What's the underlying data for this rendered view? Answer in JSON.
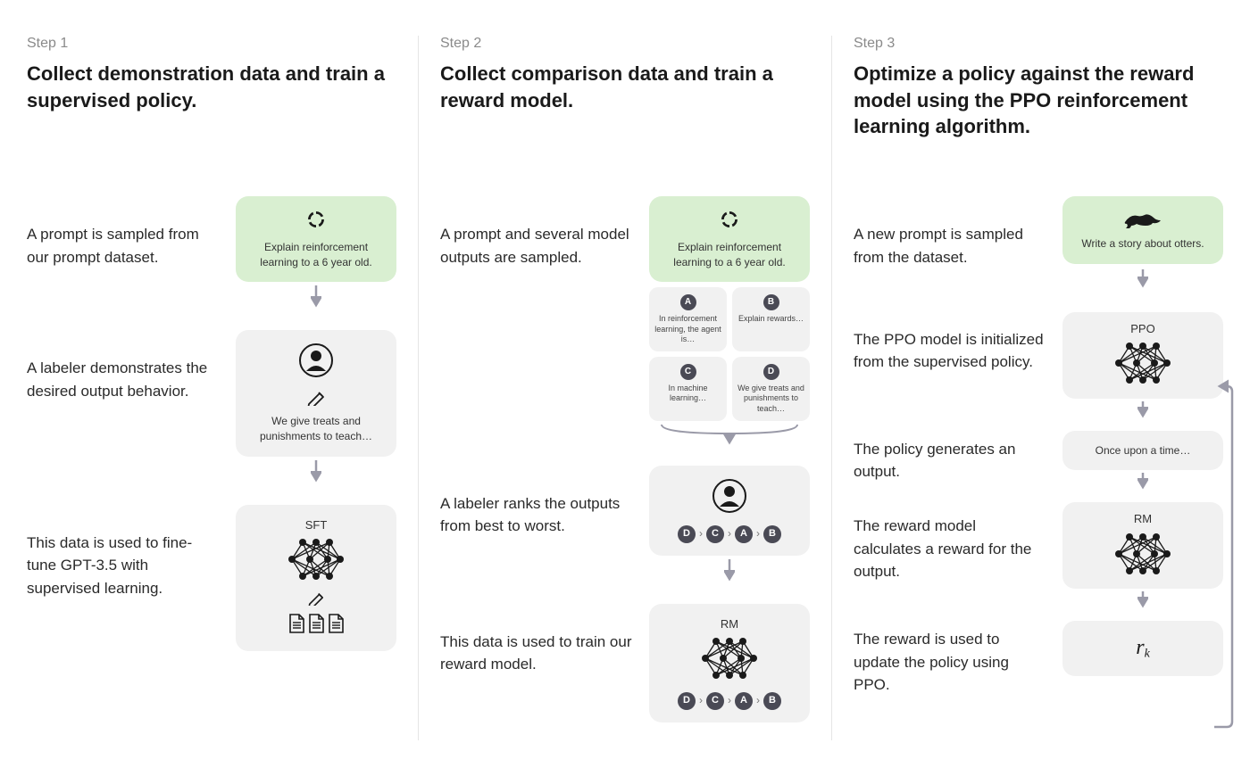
{
  "steps": [
    {
      "label": "Step 1",
      "title": "Collect demonstration data and train a supervised policy.",
      "rows": [
        {
          "text": "A prompt is sampled from our prompt dataset.",
          "prompt": "Explain reinforcement learning to a 6 year old."
        },
        {
          "text": "A labeler demonstrates the desired output behavior.",
          "demo": "We give treats and punishments to teach…"
        },
        {
          "text": "This data is used to fine-tune GPT-3.5 with supervised learning.",
          "model": "SFT"
        }
      ]
    },
    {
      "label": "Step 2",
      "title": "Collect comparison data and train a reward model.",
      "rows": [
        {
          "text": "A prompt and several model outputs are sampled.",
          "prompt": "Explain reinforcement learning to a 6 year old.",
          "options": [
            {
              "letter": "A",
              "text": "In reinforcement learning, the agent is…"
            },
            {
              "letter": "B",
              "text": "Explain rewards…"
            },
            {
              "letter": "C",
              "text": "In machine learning…"
            },
            {
              "letter": "D",
              "text": "We give treats and punishments to teach…"
            }
          ]
        },
        {
          "text": "A labeler ranks the outputs from best to worst.",
          "ranking": [
            "D",
            "C",
            "A",
            "B"
          ]
        },
        {
          "text": "This data is used to train our reward model.",
          "model": "RM",
          "ranking": [
            "D",
            "C",
            "A",
            "B"
          ]
        }
      ]
    },
    {
      "label": "Step 3",
      "title": "Optimize a policy against the reward model using the PPO reinforcement learning algorithm.",
      "rows": [
        {
          "text": "A new prompt is sampled from the dataset.",
          "prompt": "Write a story about otters."
        },
        {
          "text": "The PPO model is initialized from the supervised policy.",
          "model": "PPO"
        },
        {
          "text": "The policy generates an output.",
          "output": "Once upon a time…"
        },
        {
          "text": "The reward model calculates a reward for the output.",
          "model": "RM"
        },
        {
          "text": "The reward is used to update the policy using PPO.",
          "reward": "r",
          "reward_sub": "k"
        }
      ]
    }
  ]
}
